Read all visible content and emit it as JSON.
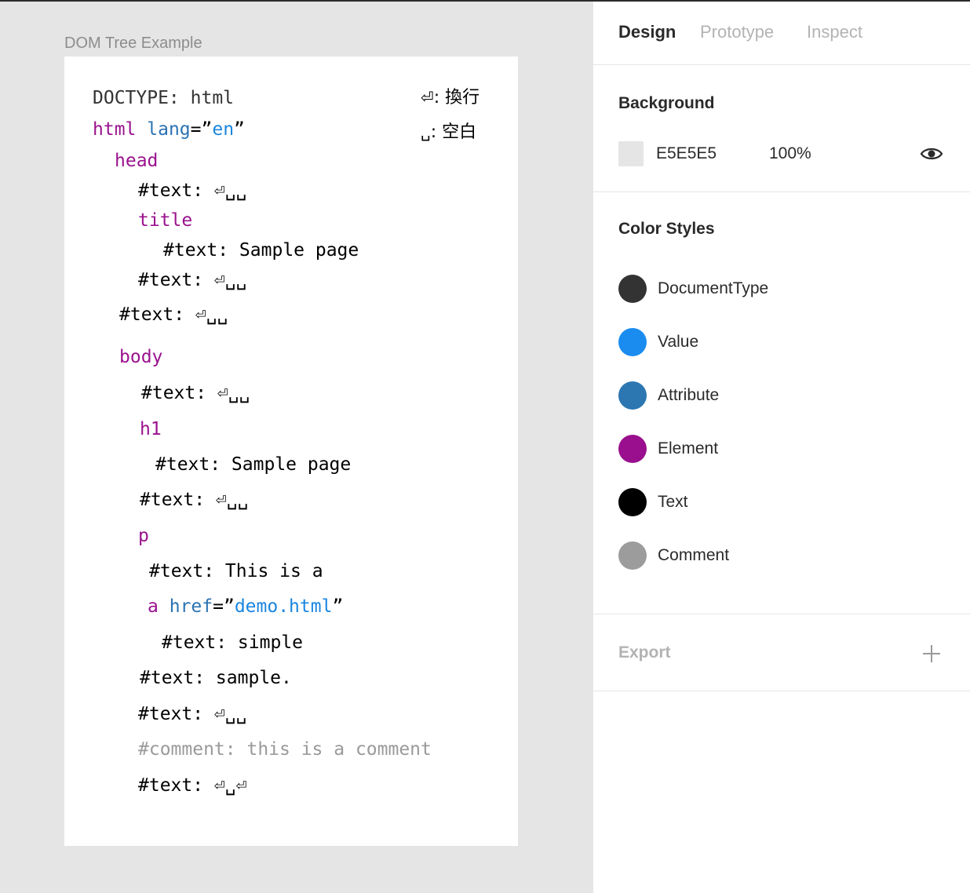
{
  "canvas": {
    "frame_title": "DOM Tree Example",
    "legend": [
      {
        "glyph": "⏎",
        "text": ": 換行"
      },
      {
        "glyph": "␣",
        "text": ": 空白"
      }
    ],
    "tree": {
      "doctype": "DOCTYPE: html",
      "html": {
        "tag": "html",
        "attr": "lang",
        "eq": "=”",
        "value": "en",
        "close": "”"
      },
      "head": "head",
      "head_text1": "#text: ⏎␣␣",
      "title": "title",
      "title_text": "#text: Sample page",
      "head_text2": "#text: ⏎␣␣",
      "html_text": "#text: ⏎␣␣",
      "body": "body",
      "body_text1": "#text: ⏎␣␣",
      "h1": "h1",
      "h1_text": "#text: Sample page",
      "body_text2": "#text: ⏎␣␣",
      "p": "p",
      "p_text": "#text: This is a",
      "a": {
        "tag": "a",
        "attr": "href",
        "eq": "=”",
        "value": "demo.html",
        "close": "”"
      },
      "a_text": "#text: simple",
      "p_text2": "#text: sample.",
      "body_text3": "#text: ⏎␣␣",
      "comment": "#comment: this is a comment",
      "body_text4": "#text: ⏎␣⏎"
    }
  },
  "panel": {
    "tabs": [
      "Design",
      "Prototype",
      "Inspect"
    ],
    "background": {
      "title": "Background",
      "hex": "E5E5E5",
      "opacity": "100%",
      "color": "#E5E5E5"
    },
    "color_styles": {
      "title": "Color Styles",
      "items": [
        {
          "name": "DocumentType",
          "color": "#333333"
        },
        {
          "name": "Value",
          "color": "#1A8CF0"
        },
        {
          "name": "Attribute",
          "color": "#2C77B2"
        },
        {
          "name": "Element",
          "color": "#9A0F8E"
        },
        {
          "name": "Text",
          "color": "#000000"
        },
        {
          "name": "Comment",
          "color": "#9C9C9C"
        }
      ]
    },
    "export": {
      "title": "Export"
    }
  }
}
